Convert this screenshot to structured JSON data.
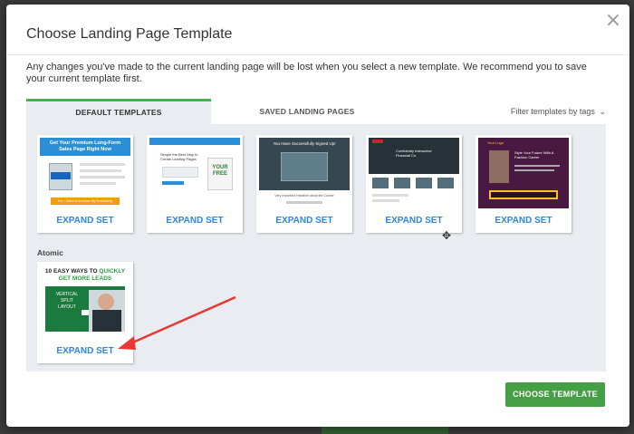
{
  "modal": {
    "title": "Choose Landing Page Template",
    "description": "Any changes you've made to the current landing page will be lost when you select a new template. We recommend you to save your current template first.",
    "close_icon": "×"
  },
  "tabs": [
    {
      "label": "DEFAULT TEMPLATES",
      "active": true
    },
    {
      "label": "SAVED LANDING PAGES",
      "active": false
    }
  ],
  "filter": {
    "label": "Filter templates by tags",
    "icon": "chevron-down-icon",
    "glyph": "⌄"
  },
  "templates_top": [
    {
      "expand_label": "EXPAND SET",
      "thumb_title": "Get Your Premium Long-Form Sales Page Right Now",
      "thumb_button": "Yes, I Want to Increase My Productivity"
    },
    {
      "expand_label": "EXPAND SET",
      "thumb_title": "Simple the Best Way to Create Landing Pages",
      "thumb_badge": "YOUR FREE"
    },
    {
      "expand_label": "EXPAND SET",
      "thumb_title": "You Have Successfully Signed Up!",
      "thumb_caption": "Very Important Headline about the Course"
    },
    {
      "expand_label": "EXPAND SET",
      "thumb_title": "Confidently Interactive Financial Co"
    },
    {
      "expand_label": "EXPAND SET",
      "thumb_title": "Style Your Future With A Fashion Career",
      "thumb_logo": "Your Logo"
    }
  ],
  "group": {
    "label": "Atomic",
    "templates": [
      {
        "expand_label": "EXPAND SET",
        "headline_a": "10 EASY WAYS TO",
        "headline_b": "QUICKLY",
        "headline_c": "GET MORE LEADS",
        "tag_1": "VERTICAL",
        "tag_2": "SPLIT",
        "tag_3": "LAYOUT"
      }
    ]
  },
  "footer": {
    "choose_label": "CHOOSE TEMPLATE"
  },
  "colors": {
    "accent_green": "#45b549",
    "button_green": "#45a045",
    "link_blue": "#2e86de",
    "arrow_red": "#e53935"
  }
}
